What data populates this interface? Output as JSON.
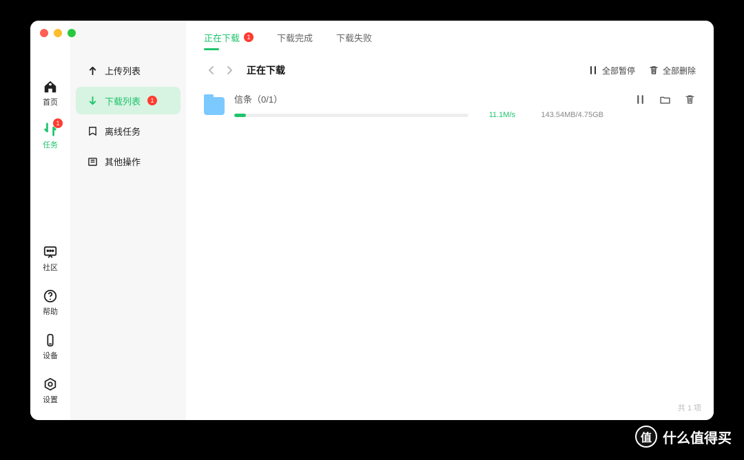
{
  "nav": {
    "home": "首页",
    "task": "任务",
    "task_badge": "1",
    "community": "社区",
    "help": "帮助",
    "device": "设备",
    "settings": "设置"
  },
  "sidebar": {
    "upload": "上传列表",
    "download": "下载列表",
    "download_badge": "1",
    "offline": "离线任务",
    "other": "其他操作"
  },
  "tabs": {
    "downloading": "正在下载",
    "downloading_badge": "1",
    "done": "下载完成",
    "failed": "下载失败"
  },
  "header": {
    "title": "正在下载",
    "pause_all": "全部暂停",
    "delete_all": "全部删除"
  },
  "item": {
    "name": "信条（0/1）",
    "speed": "11.1M/s",
    "size": "143.54MB/4.75GB",
    "progress_pct": 5
  },
  "footer": "共 1 项",
  "watermark": {
    "icon": "值",
    "text": "什么值得买"
  }
}
